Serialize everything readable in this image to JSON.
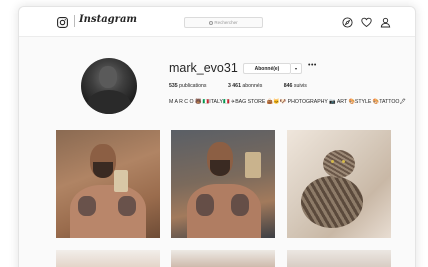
{
  "nav": {
    "wordmark": "Instagram",
    "search_placeholder": "Rechercher",
    "icons": [
      "instagram-glyph-icon",
      "compass-icon",
      "heart-icon",
      "person-icon"
    ]
  },
  "profile": {
    "username": "mark_evo31",
    "follow_label": "Abonné(e)",
    "caret": "▾",
    "more": "•••",
    "stats": {
      "posts_count": "535",
      "posts_label": "publications",
      "followers_count": "3 461",
      "followers_label": "abonnés",
      "following_count": "846",
      "following_label": "suivis"
    },
    "bio": "M A R C O 🐻 🇮🇹ITALY🇮🇹 ✈BAG STORE 👜🐱🐶 PHOTOGRAPHY 📷 ART 🎨STYLE 🎨TATTOO🖋"
  },
  "grid": {
    "tiles": [
      "selfie-mirror-1",
      "selfie-mirror-2",
      "cat",
      "photo-4",
      "photo-5",
      "photo-6"
    ]
  },
  "colors": {
    "text": "#262626",
    "border": "#dbdbdb",
    "background": "#fafafa"
  }
}
